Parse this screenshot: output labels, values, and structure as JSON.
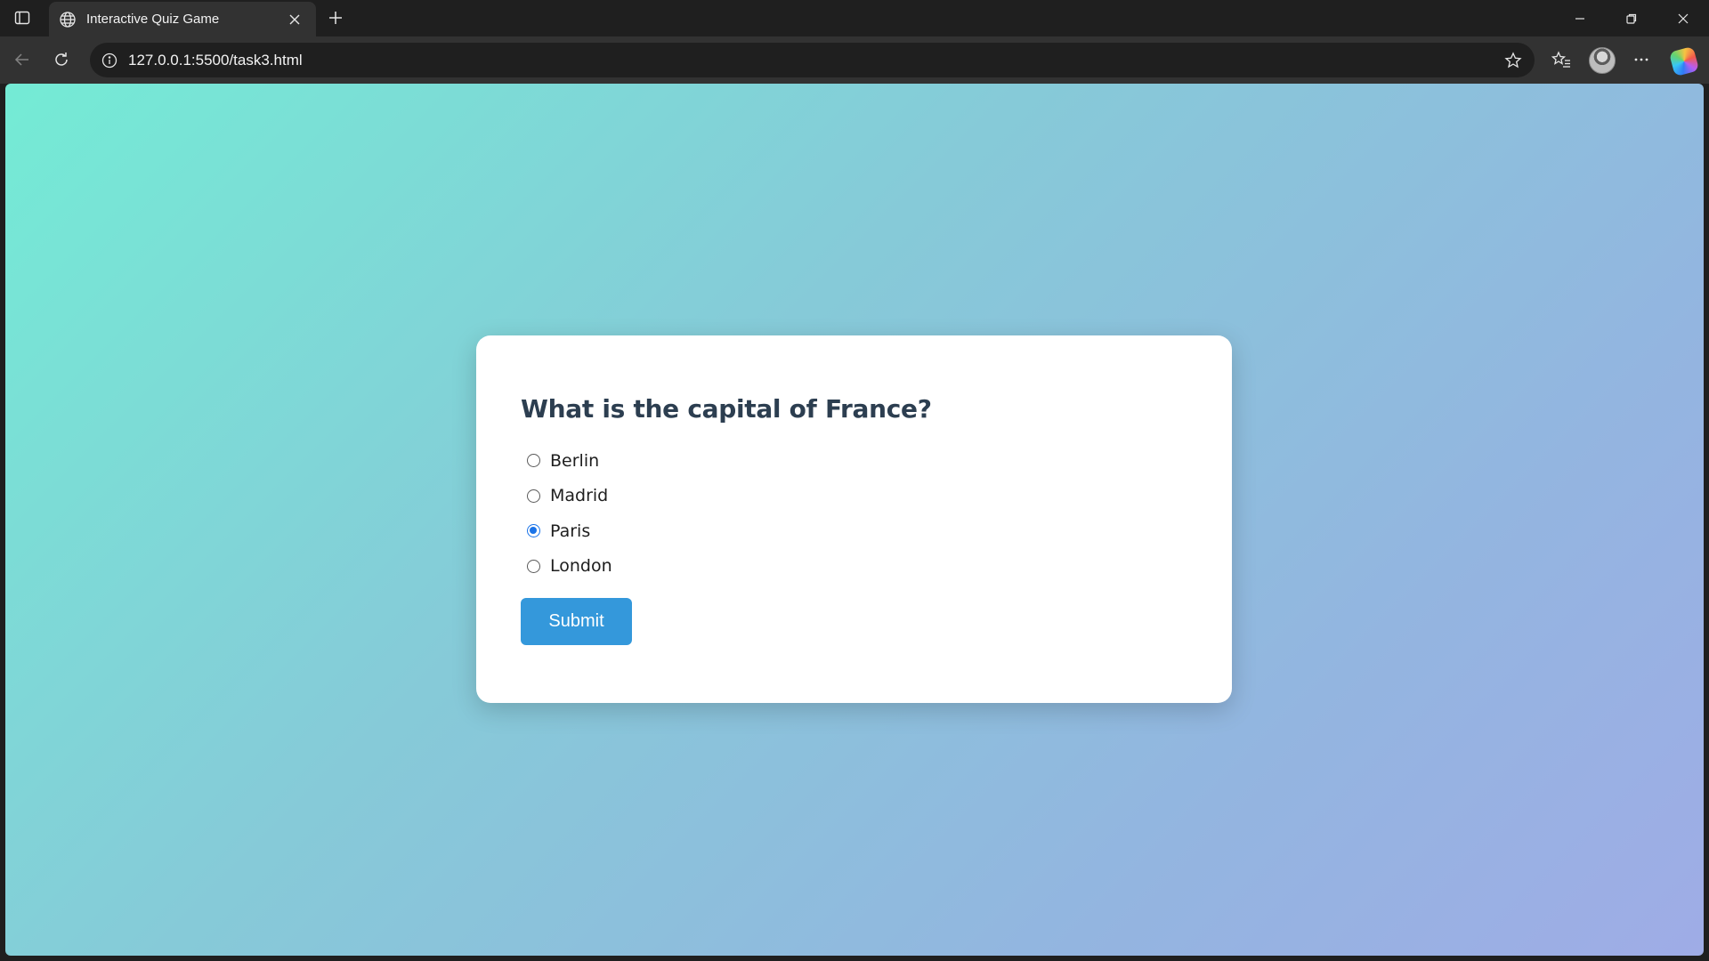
{
  "browser": {
    "tab": {
      "title": "Interactive Quiz Game",
      "icon": "globe-icon"
    },
    "url": "127.0.0.1:5500/task3.html"
  },
  "quiz": {
    "question": "What is the capital of France?",
    "options": [
      {
        "label": "Berlin",
        "checked": false
      },
      {
        "label": "Madrid",
        "checked": false
      },
      {
        "label": "Paris",
        "checked": true
      },
      {
        "label": "London",
        "checked": false
      }
    ],
    "submit_label": "Submit"
  },
  "colors": {
    "background_gradient": [
      "#74ebd5",
      "#9face6"
    ],
    "question_text": "#2c3e50",
    "submit_button": "#3498db",
    "radio_checked": "#1a73e8"
  }
}
